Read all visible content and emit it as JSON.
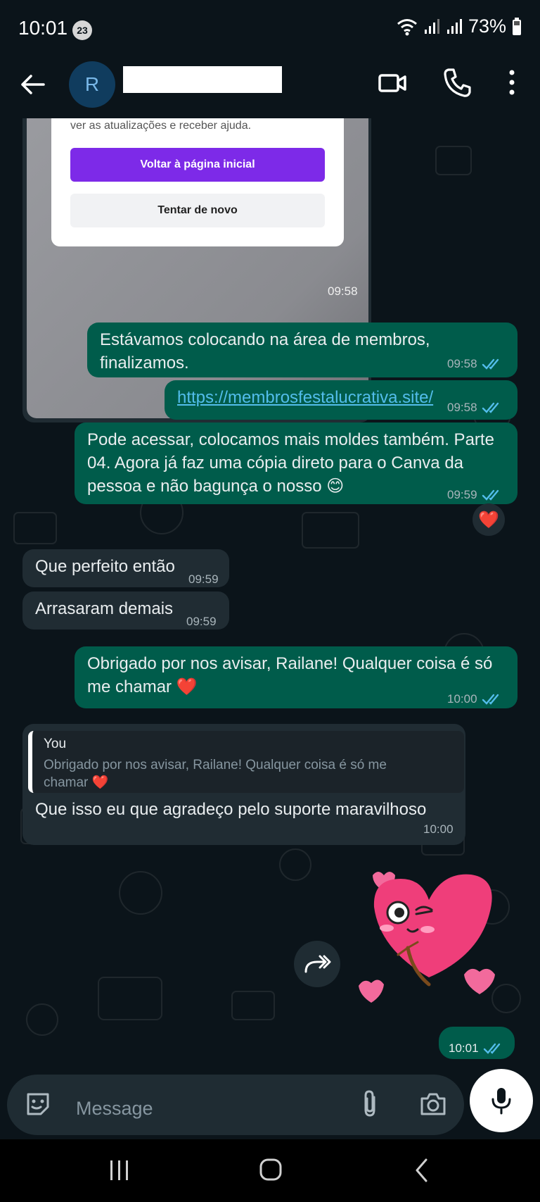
{
  "status_bar": {
    "time": "10:01",
    "notification_count": "23",
    "battery": "73%"
  },
  "header": {
    "avatar_letter": "R",
    "contact_name": ""
  },
  "image_message": {
    "card_text": "ver as atualizações e receber ajuda.",
    "primary_button": "Voltar à página inicial",
    "secondary_button": "Tentar de novo",
    "time": "09:58"
  },
  "messages": [
    {
      "direction": "out",
      "text": "Estávamos colocando na área de membros, finalizamos.",
      "time": "09:58",
      "read": true
    },
    {
      "direction": "out",
      "text": "https://membrosfestalucrativa.site/",
      "time": "09:58",
      "read": true,
      "is_link": true
    },
    {
      "direction": "out",
      "text": "Pode acessar, colocamos mais moldes também. Parte 04. Agora já faz uma cópia direto para o Canva da pessoa e não bagunça o nosso 😊",
      "time": "09:59",
      "read": true,
      "reaction": "❤️"
    },
    {
      "direction": "in",
      "text": "Que perfeito então",
      "time": "09:59"
    },
    {
      "direction": "in",
      "text": "Arrasaram demais",
      "time": "09:59"
    },
    {
      "direction": "out",
      "text": "Obrigado por nos avisar, Railane! Qualquer coisa é só me chamar ❤️",
      "time": "10:00",
      "read": true
    },
    {
      "direction": "in",
      "quote_author": "You",
      "quote_text": "Obrigado por nos avisar, Railane! Qualquer coisa é só me chamar ❤️",
      "text": "Que isso eu que agradeço pelo suporte maravilhoso",
      "time": "10:00"
    },
    {
      "direction": "out",
      "type": "sticker",
      "time": "10:01",
      "read": true
    }
  ],
  "input": {
    "placeholder": "Message"
  },
  "colors": {
    "background": "#0b141a",
    "outgoing_bubble": "#005c4b",
    "incoming_bubble": "#202c33",
    "read_ticks": "#53bdeb"
  }
}
